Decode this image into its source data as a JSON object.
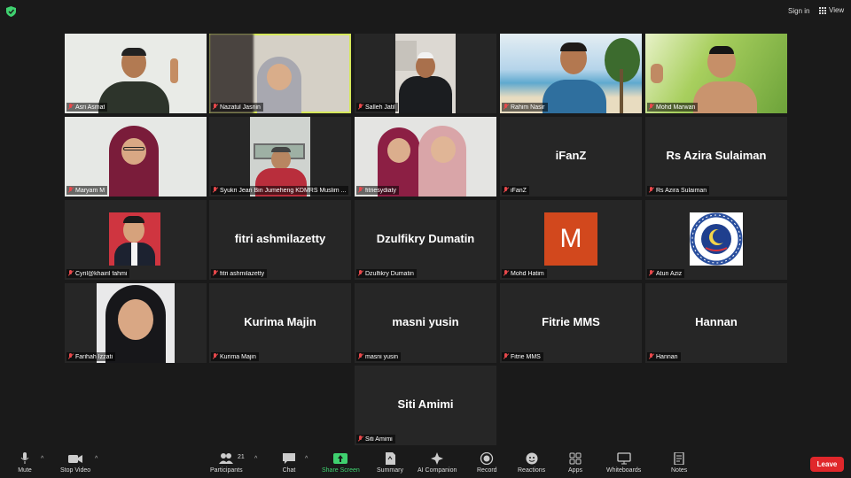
{
  "topbar": {
    "signin_label": "Sign in",
    "view_label": "View"
  },
  "participants": [
    {
      "label": "Asri Asmat"
    },
    {
      "label": "Nazatul Jasnin"
    },
    {
      "label": "Salleh Jatil"
    },
    {
      "label": "Rahim Nasir"
    },
    {
      "label": "Mohd Marwan"
    },
    {
      "label": "Maryam M"
    },
    {
      "label": "Syukri Jean Bin Jumeheng KDMRS Muslim ..."
    },
    {
      "label": "fitriesydiaty"
    },
    {
      "label": "iFanZ",
      "display_name": "iFanZ"
    },
    {
      "label": "Rs Azira Sulaiman",
      "display_name": "Rs Azira Sulaiman"
    },
    {
      "label": "Cyril@khairil fahmi"
    },
    {
      "label": "fitri ashmilazetty",
      "display_name": "fitri ashmilazetty"
    },
    {
      "label": "Dzulfikry Dumatin",
      "display_name": "Dzulfikry Dumatin"
    },
    {
      "label": "Mohd Hatim",
      "avatar_letter": "M",
      "avatar_color": "#d2481d"
    },
    {
      "label": "Atun Aziz"
    },
    {
      "label": "Farihah Izzati"
    },
    {
      "label": "Kurima Majin",
      "display_name": "Kurima Majin"
    },
    {
      "label": "masni yusin",
      "display_name": "masni yusin"
    },
    {
      "label": "Fitrie MMS",
      "display_name": "Fitrie MMS"
    },
    {
      "label": "Hannan",
      "display_name": "Hannan"
    },
    {
      "label": "Siti Amimi",
      "display_name": "Siti Amimi"
    }
  ],
  "toolbar": {
    "mute": "Mute",
    "stop_video": "Stop Video",
    "participants": "Participants",
    "participants_count": "21",
    "chat": "Chat",
    "share_screen": "Share Screen",
    "summary": "Summary",
    "ai_companion": "AI Companion",
    "record": "Record",
    "reactions": "Reactions",
    "apps": "Apps",
    "whiteboards": "Whiteboards",
    "notes": "Notes",
    "leave": "Leave"
  },
  "colors": {
    "active_speaker": "#d6e85a",
    "share_green": "#3fd16f",
    "leave_red": "#e0272b",
    "muted_red": "#e8484b"
  },
  "icons": [
    "shield-icon",
    "grid-icon",
    "mic-icon",
    "video-icon",
    "participants-icon",
    "chat-icon",
    "share-screen-icon",
    "summary-icon",
    "ai-companion-icon",
    "record-icon",
    "reactions-icon",
    "apps-icon",
    "whiteboards-icon",
    "notes-icon"
  ]
}
